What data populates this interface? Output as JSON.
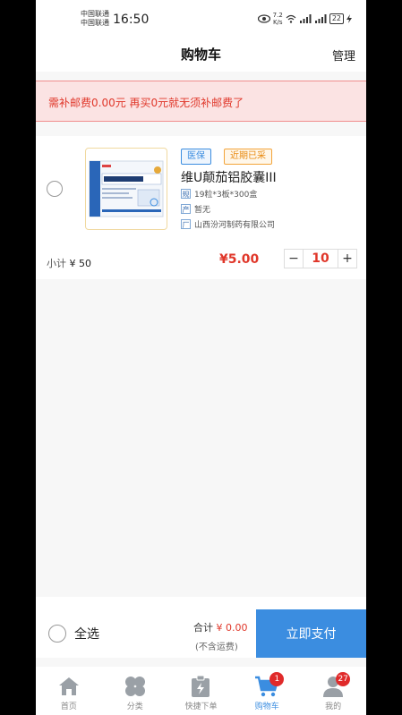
{
  "status_bar": {
    "carrier_line1": "中国联通",
    "carrier_line2": "中国联通",
    "time": "16:50",
    "net_speed": "7.2",
    "net_unit": "K/s",
    "battery": "22"
  },
  "header": {
    "title": "购物车",
    "manage": "管理"
  },
  "notice": {
    "text": "需补邮费0.00元 再买0元就无须补邮费了"
  },
  "cart_item": {
    "tags": [
      "医保",
      "近期已采"
    ],
    "name": "维U颠茄铝胶囊III",
    "spec_icon": "规",
    "spec": "19粒*3板*300盒",
    "origin_icon": "产",
    "origin": "暂无",
    "maker_icon": "厂",
    "maker": "山西汾河制药有限公司",
    "subtotal_label": "小计",
    "subtotal_value": "¥ 50",
    "price": "¥5.00",
    "quantity": "10",
    "minus": "−",
    "plus": "+"
  },
  "bottom": {
    "select_all": "全选",
    "total_label": "合计",
    "total_value": "¥ 0.00",
    "shipping_note": "(不含运费)",
    "pay_button": "立即支付"
  },
  "tabs": [
    {
      "label": "首页",
      "icon": "home-icon"
    },
    {
      "label": "分类",
      "icon": "category-icon"
    },
    {
      "label": "快捷下单",
      "icon": "quick-order-icon"
    },
    {
      "label": "购物车",
      "icon": "cart-icon",
      "badge": "1",
      "active": true
    },
    {
      "label": "我的",
      "icon": "user-icon",
      "badge": "27"
    }
  ],
  "colors": {
    "accent": "#3b8de0",
    "price_red": "#e0372a",
    "notice_bg": "#fbe3e3"
  }
}
